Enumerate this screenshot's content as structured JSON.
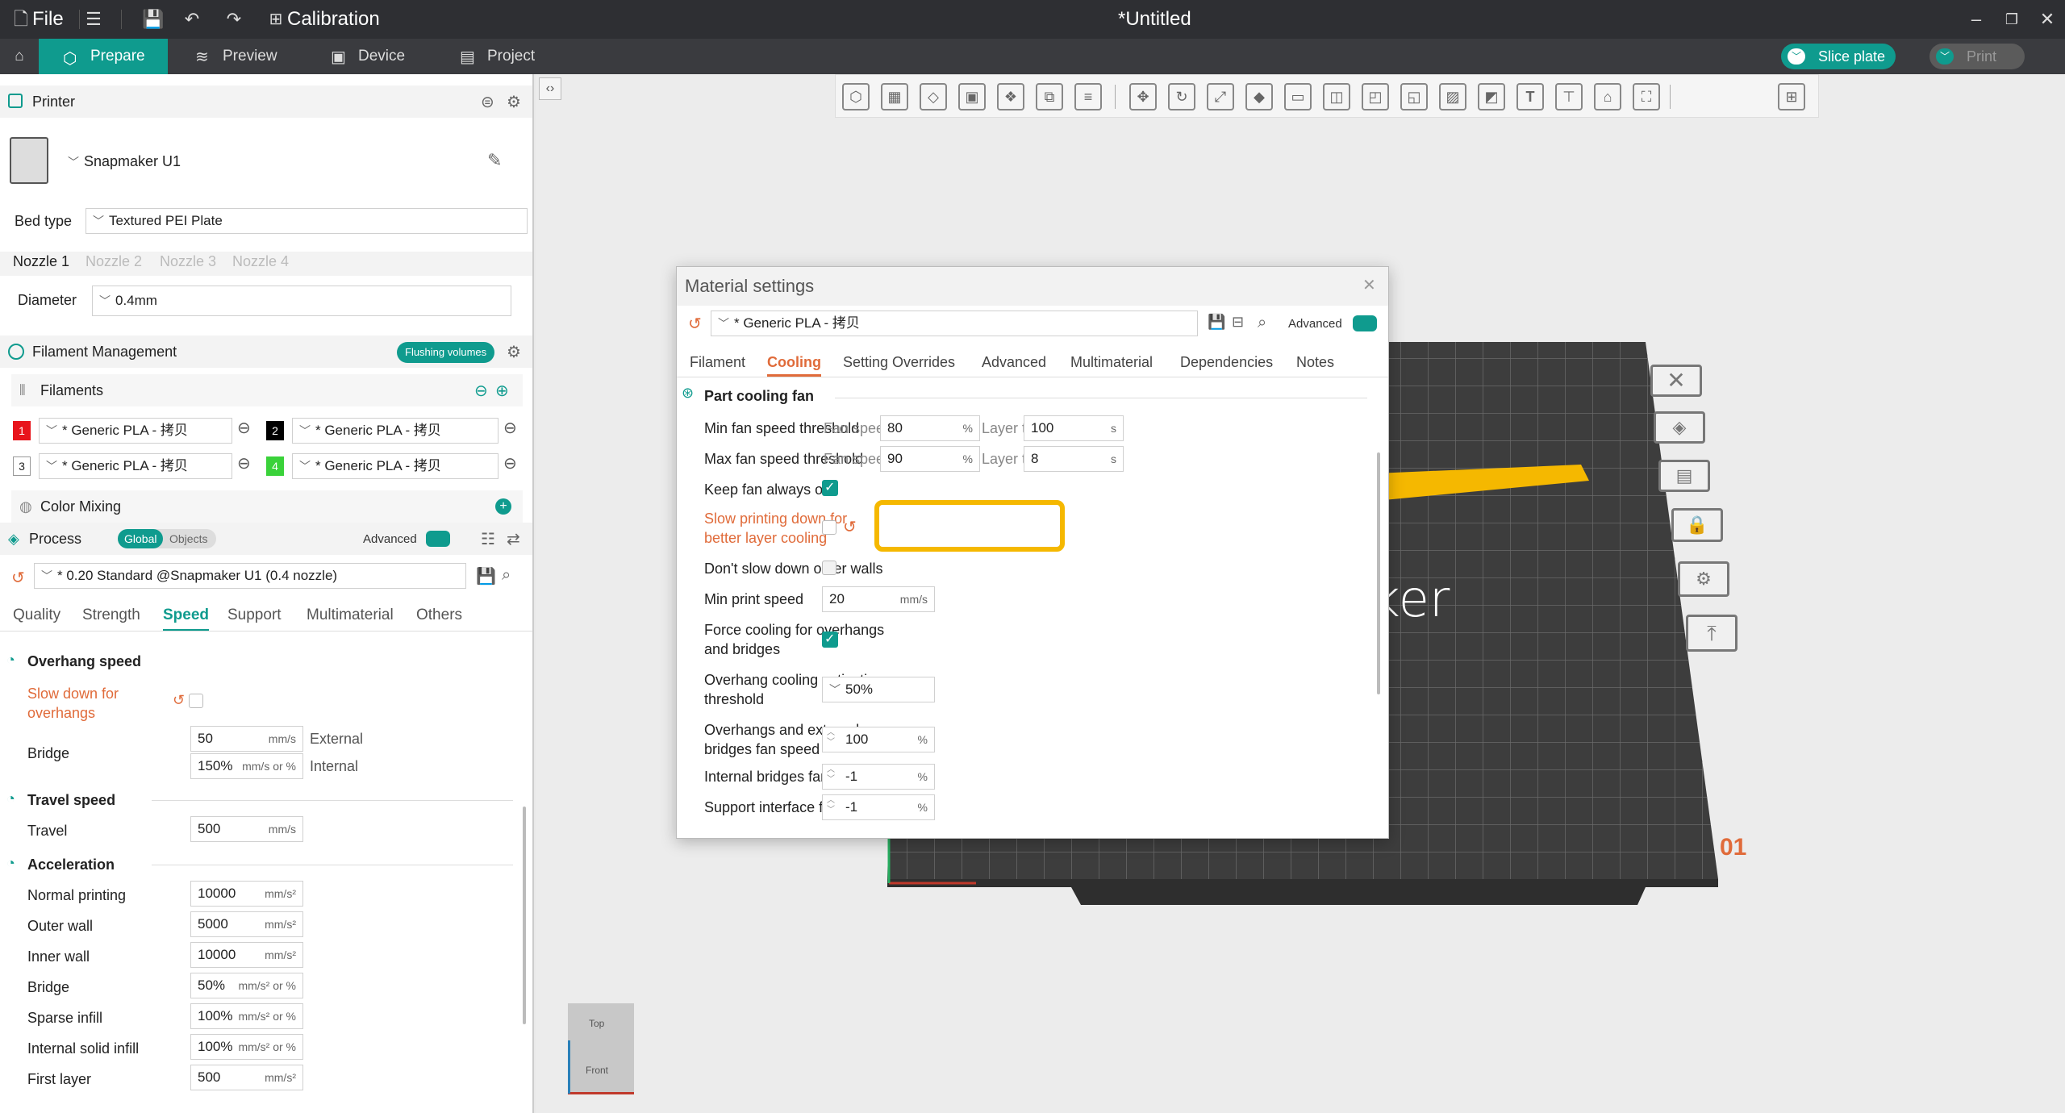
{
  "titlebar": {
    "file": "File",
    "calibration": "Calibration",
    "doc_title": "*Untitled"
  },
  "tabs": {
    "prepare": "Prepare",
    "preview": "Preview",
    "device": "Device",
    "project": "Project",
    "slice": "Slice plate",
    "print": "Print"
  },
  "printer": {
    "section": "Printer",
    "name": "Snapmaker U1",
    "bed_type_label": "Bed type",
    "bed_type": "Textured PEI Plate",
    "nozzles": [
      "Nozzle 1",
      "Nozzle 2",
      "Nozzle 3",
      "Nozzle 4"
    ],
    "diameter_label": "Diameter",
    "diameter": "0.4mm"
  },
  "filament": {
    "section": "Filament Management",
    "flushing": "Flushing volumes",
    "filaments_label": "Filaments",
    "items": [
      {
        "num": "1",
        "name": "* Generic PLA - 拷贝",
        "color": "#e8141c"
      },
      {
        "num": "2",
        "name": "* Generic PLA - 拷贝",
        "color": "#000000"
      },
      {
        "num": "3",
        "name": "* Generic PLA - 拷贝",
        "color": "#ffffff"
      },
      {
        "num": "4",
        "name": "* Generic PLA - 拷贝",
        "color": "#3ad23a"
      }
    ],
    "color_mixing": "Color Mixing"
  },
  "process": {
    "section": "Process",
    "global": "Global",
    "objects": "Objects",
    "advanced": "Advanced",
    "preset": "* 0.20 Standard @Snapmaker U1 (0.4 nozzle)",
    "tabs": [
      "Quality",
      "Strength",
      "Speed",
      "Support",
      "Multimaterial",
      "Others"
    ],
    "overhang_title": "Overhang speed",
    "slow_down": "Slow down for overhangs",
    "bridge": "Bridge",
    "bridge_ext": "50",
    "bridge_ext_unit": "mm/s",
    "external": "External",
    "bridge_int": "150%",
    "bridge_int_unit": "mm/s or %",
    "internal": "Internal",
    "travel_title": "Travel speed",
    "travel": "Travel",
    "travel_val": "500",
    "travel_unit": "mm/s",
    "accel_title": "Acceleration",
    "accel": [
      {
        "label": "Normal printing",
        "val": "10000",
        "unit": "mm/s²"
      },
      {
        "label": "Outer wall",
        "val": "5000",
        "unit": "mm/s²"
      },
      {
        "label": "Inner wall",
        "val": "10000",
        "unit": "mm/s²"
      },
      {
        "label": "Bridge",
        "val": "50%",
        "unit": "mm/s² or %"
      },
      {
        "label": "Sparse infill",
        "val": "100%",
        "unit": "mm/s² or %"
      },
      {
        "label": "Internal solid infill",
        "val": "100%",
        "unit": "mm/s² or %"
      },
      {
        "label": "First layer",
        "val": "500",
        "unit": "mm/s²"
      }
    ]
  },
  "dialog": {
    "title": "Material settings",
    "preset": "* Generic PLA - 拷贝",
    "advanced": "Advanced",
    "tabs": [
      "Filament",
      "Cooling",
      "Setting Overrides",
      "Advanced",
      "Multimaterial",
      "Dependencies",
      "Notes"
    ],
    "section": "Part cooling fan",
    "min_fan": "Min fan speed threshold",
    "max_fan": "Max fan speed threshold",
    "fan_speed": "Fan speed",
    "layer_time": "Layer time",
    "min_fan_val": "80",
    "max_fan_val": "90",
    "min_lt": "100",
    "max_lt": "8",
    "pct": "%",
    "sec": "s",
    "keep_fan": "Keep fan always on",
    "slow_print": "Slow printing down for better layer cooling",
    "dont_slow": "Don't slow down outer walls",
    "min_print_speed": "Min print speed",
    "min_print_val": "20",
    "mms": "mm/s",
    "force_cool": "Force cooling for overhangs and bridges",
    "overhang_thr": "Overhang cooling activation threshold",
    "overhang_thr_val": "50%",
    "oh_fan": "Overhangs and external bridges fan speed",
    "oh_fan_val": "100",
    "int_bridge": "Internal bridges fan speed",
    "int_bridge_val": "-1",
    "support_fan": "Support interface fan speed",
    "support_fan_val": "-1"
  },
  "view": {
    "top": "Top",
    "front": "Front",
    "plate_num": "01",
    "brand": "ker"
  },
  "colors": {
    "accent": "#0f9b8e",
    "orange": "#e06b3a",
    "highlight": "#f5b800"
  }
}
